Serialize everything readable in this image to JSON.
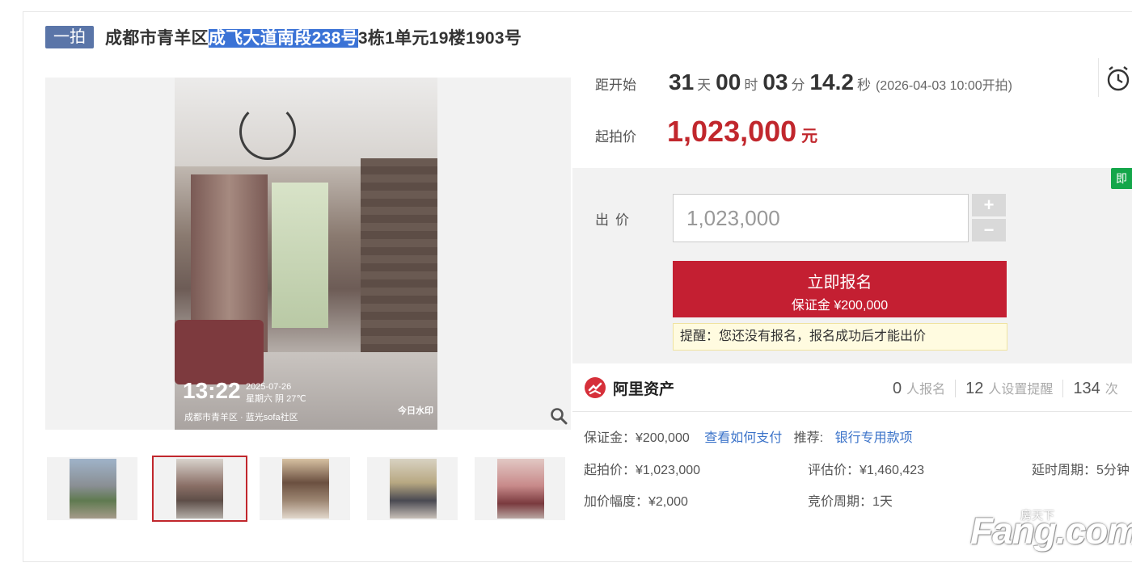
{
  "header": {
    "tag": "一拍",
    "title_pre": "成都市青羊区",
    "title_highlight": "成飞大道南段238号",
    "title_post": "3栋1单元19楼1903号"
  },
  "gallery": {
    "photo_time": "13:22",
    "photo_date": "2025-07-26",
    "photo_weekday": "星期六 阴 27℃",
    "photo_location": "成都市青羊区 · 蓝光sofa社区",
    "photo_watermark": "今日水印",
    "thumbnail_count": 5,
    "active_thumbnail": 2
  },
  "countdown": {
    "label": "距开始",
    "days": "31",
    "days_unit": "天",
    "hours": "00",
    "hours_unit": "时",
    "minutes": "03",
    "minutes_unit": "分",
    "seconds": "14.2",
    "seconds_unit": "秒",
    "note": "(2026-04-03 10:00开拍)"
  },
  "start_price": {
    "label": "起拍价",
    "value": "1,023,000",
    "unit": "元"
  },
  "bid": {
    "badge": "即",
    "label": "出价",
    "input_value": "1,023,000",
    "plus": "+",
    "minus": "−",
    "signup_label": "立即报名",
    "signup_deposit": "保证金 ¥200,000",
    "notice": "提醒：您还没有报名，报名成功后才能出价"
  },
  "brand": {
    "name": "阿里资产"
  },
  "stats": {
    "signups": "0",
    "signups_label": "人报名",
    "reminders": "12",
    "reminders_label": "人设置提醒",
    "views": "134",
    "views_label": "次"
  },
  "info": {
    "deposit": "保证金：¥200,000",
    "how_to_pay": "查看如何支付",
    "recommend_label": "推荐:",
    "recommend_link": "银行专用款项",
    "start_price": "起拍价：¥1,023,000",
    "appraisal": "评估价：¥1,460,423",
    "delay": "延时周期：5分钟",
    "increment": "加价幅度：¥2,000",
    "cycle": "竞价周期：1天"
  },
  "watermark": {
    "text": "Fang.com",
    "sub": "房天下"
  },
  "colors": {
    "accent_red": "#c41f32",
    "tag_blue": "#5a75a8",
    "link_blue": "#3b73c9",
    "green_badge": "#14a64a"
  }
}
